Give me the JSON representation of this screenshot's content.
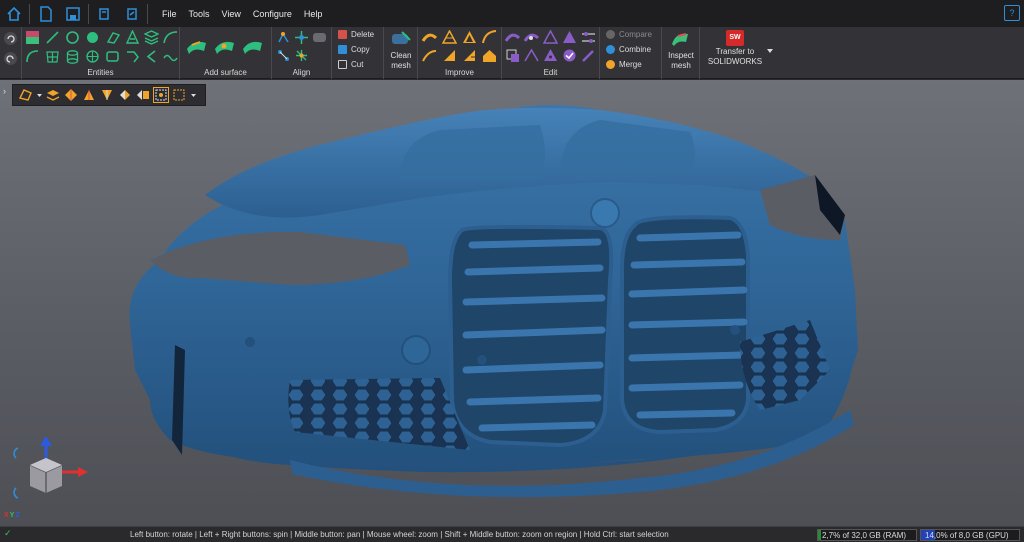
{
  "menu": {
    "items": [
      "File",
      "Tools",
      "View",
      "Configure",
      "Help"
    ]
  },
  "help_label": "?",
  "ribbon": {
    "entities_label": "Entities",
    "add_surface_label": "Add surface",
    "align_label": "Align",
    "clipboard": {
      "delete": "Delete",
      "copy": "Copy",
      "cut": "Cut"
    },
    "clean_mesh": [
      "Clean",
      "mesh"
    ],
    "improve_label": "Improve",
    "edit_label": "Edit",
    "compare": {
      "compare": "Compare",
      "combine": "Combine",
      "merge": "Merge"
    },
    "inspect_mesh": [
      "Inspect",
      "mesh"
    ],
    "transfer": [
      "Transfer to",
      "SOLIDWORKS"
    ],
    "sw_logo": "SW"
  },
  "viewport": {
    "axis_labels": "XYZ"
  },
  "status": {
    "hint": "Left button: rotate  |  Left + Right buttons: spin  |  Middle button: pan  |  Mouse wheel: zoom  |  Shift + Middle button: zoom on region  |  Hold Ctrl: start selection",
    "ram": "2,7% of 32,0 GB (RAM)",
    "ram_fraction": 0.027,
    "gpu": "14,0% of 8,0 GB (GPU)",
    "gpu_fraction": 0.14
  },
  "colors": {
    "accent": "#2f8fd8",
    "entity_green": "#2dbf7f",
    "improve_orange": "#f0a428",
    "edit_purple": "#8a5cc8",
    "mesh_blue": "#3a6f9e"
  }
}
